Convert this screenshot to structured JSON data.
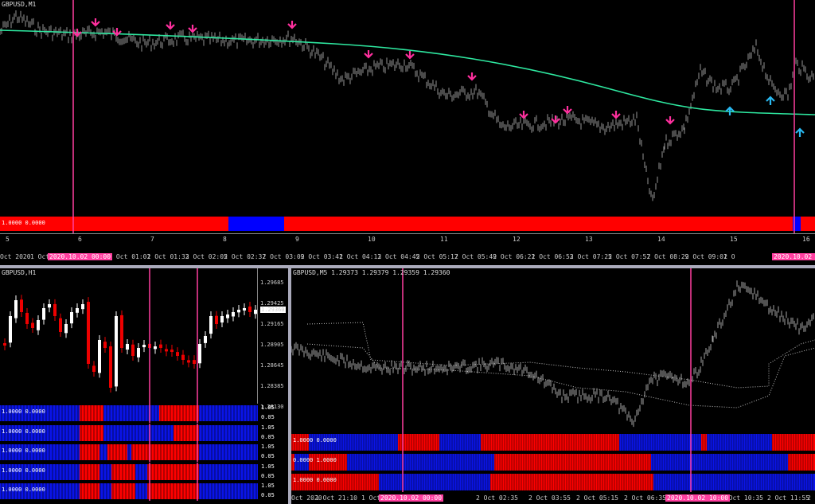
{
  "top_chart": {
    "title": "GBPUSD,M1",
    "indicator_label": "1.0000 0.0000",
    "index_labels": [
      "5",
      "6",
      "7",
      "8",
      "9",
      "10",
      "11",
      "12",
      "13",
      "14",
      "15",
      "16"
    ],
    "time_labels": [
      "Oct 2020",
      "1 Oct 2",
      "2 Oct 00:29",
      "2 Oct 01:01",
      "2 Oct 01:33",
      "2 Oct 02:05",
      "2 Oct 02:37",
      "2 Oct 03:09",
      "2 Oct 03:41",
      "2 Oct 04:13",
      "2 Oct 04:45",
      "2 Oct 05:17",
      "2 Oct 05:49",
      "2 Oct 06:21",
      "2 Oct 06:53",
      "2 Oct 07:25",
      "2 Oct 07:57",
      "2 Oct 08:29",
      "2 Oct 09:01",
      "2 O"
    ],
    "highlight_left": "2020.10.02 00:00",
    "highlight_right": "2020.10.02 10:00",
    "colors": {
      "ma": "#2ee8a0",
      "down_arrow": "#ff2f9e",
      "up_arrow": "#29b8f0",
      "vline": "#ff3fa0",
      "red": "#ff0000",
      "blue": "#0000ff"
    }
  },
  "left_chart": {
    "title": "GBPUSD,H1",
    "price_labels": [
      "1.29685",
      "1.29425",
      "1.29165",
      "1.28905",
      "1.28645",
      "1.28385",
      "1.28130"
    ],
    "current_price": "1.29360",
    "indicator_labels": [
      "1.0000 0.0000",
      "1.0000 0.0000",
      "1.0000 0.0000",
      "1.0000 0.0000",
      "1.0000 0.0000"
    ],
    "scale_labels": [
      "1.05",
      "0.05",
      "1.05",
      "0.05",
      "1.05",
      "0.05",
      "1.05",
      "0.05",
      "1.05",
      "0.05"
    ]
  },
  "right_chart": {
    "title": "GBPUSD,M5  1.29373 1.29379 1.29359 1.29360",
    "indicator_labels": [
      "1.0000 0.0000",
      "0.0000 1.0000",
      "1.0000 0.0000"
    ],
    "time_labels": [
      "Oct 2020",
      "1 Oct 21:10",
      "1 Oct 2",
      "2 Oct 01:15",
      "2 Oct 02:35",
      "2 Oct 03:55",
      "2 Oct 05:15",
      "2 Oct 06:35",
      "2 Oct 07:55",
      "2 Oct 10:35",
      "2 Oct 11:55",
      "2 Oct 13:15"
    ],
    "highlight_left": "2020.10.02 00:00",
    "highlight_right": "2020.10.02 10:00"
  }
}
